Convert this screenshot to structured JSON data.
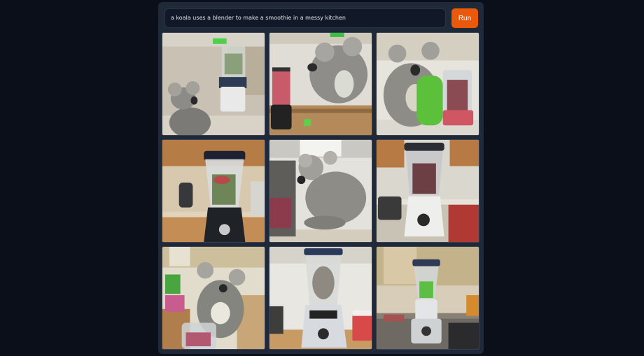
{
  "prompt": {
    "value": "a koala uses a blender to make a smoothie in a messy kitchen"
  },
  "run_button": {
    "label": "Run"
  },
  "colors": {
    "background": "#0b0f19",
    "panel": "#1f2937",
    "input": "#111827",
    "accent": "#ea580c"
  },
  "gallery": {
    "images": [
      {
        "name": "koala-blender-image-1"
      },
      {
        "name": "koala-blender-image-2"
      },
      {
        "name": "koala-blender-image-3"
      },
      {
        "name": "koala-blender-image-4"
      },
      {
        "name": "koala-blender-image-5"
      },
      {
        "name": "koala-blender-image-6"
      },
      {
        "name": "koala-blender-image-7"
      },
      {
        "name": "koala-blender-image-8"
      },
      {
        "name": "koala-blender-image-9"
      }
    ]
  }
}
